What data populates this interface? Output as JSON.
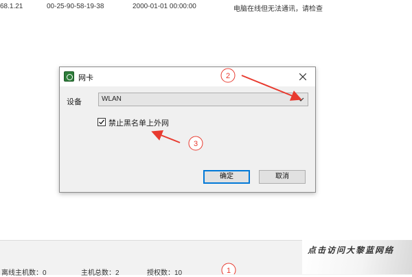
{
  "background_row": {
    "ip": "68.1.21",
    "mac": "00-25-90-58-19-38",
    "time": "2000-01-01 00:00:00",
    "status": "电脑在线但无法通讯，请检查"
  },
  "dialog": {
    "title": "网卡",
    "device_label": "设备",
    "device_value": "WLAN",
    "checkbox_label": "禁止黑名单上外网",
    "checkbox_checked": true,
    "ok_label": "确定",
    "cancel_label": "取消"
  },
  "status_bar": {
    "stat1": "离线主机数：0",
    "stat2": "主机总数：2",
    "stat3": "授权数：10",
    "watermark": "点击访问大黎蓝网络"
  },
  "annotations": {
    "marker1": "1",
    "marker2": "2",
    "marker3": "3",
    "color": "#e83a2f"
  },
  "colors": {
    "focus_border": "#0078d7",
    "icon_green": "#2e7d3a"
  }
}
